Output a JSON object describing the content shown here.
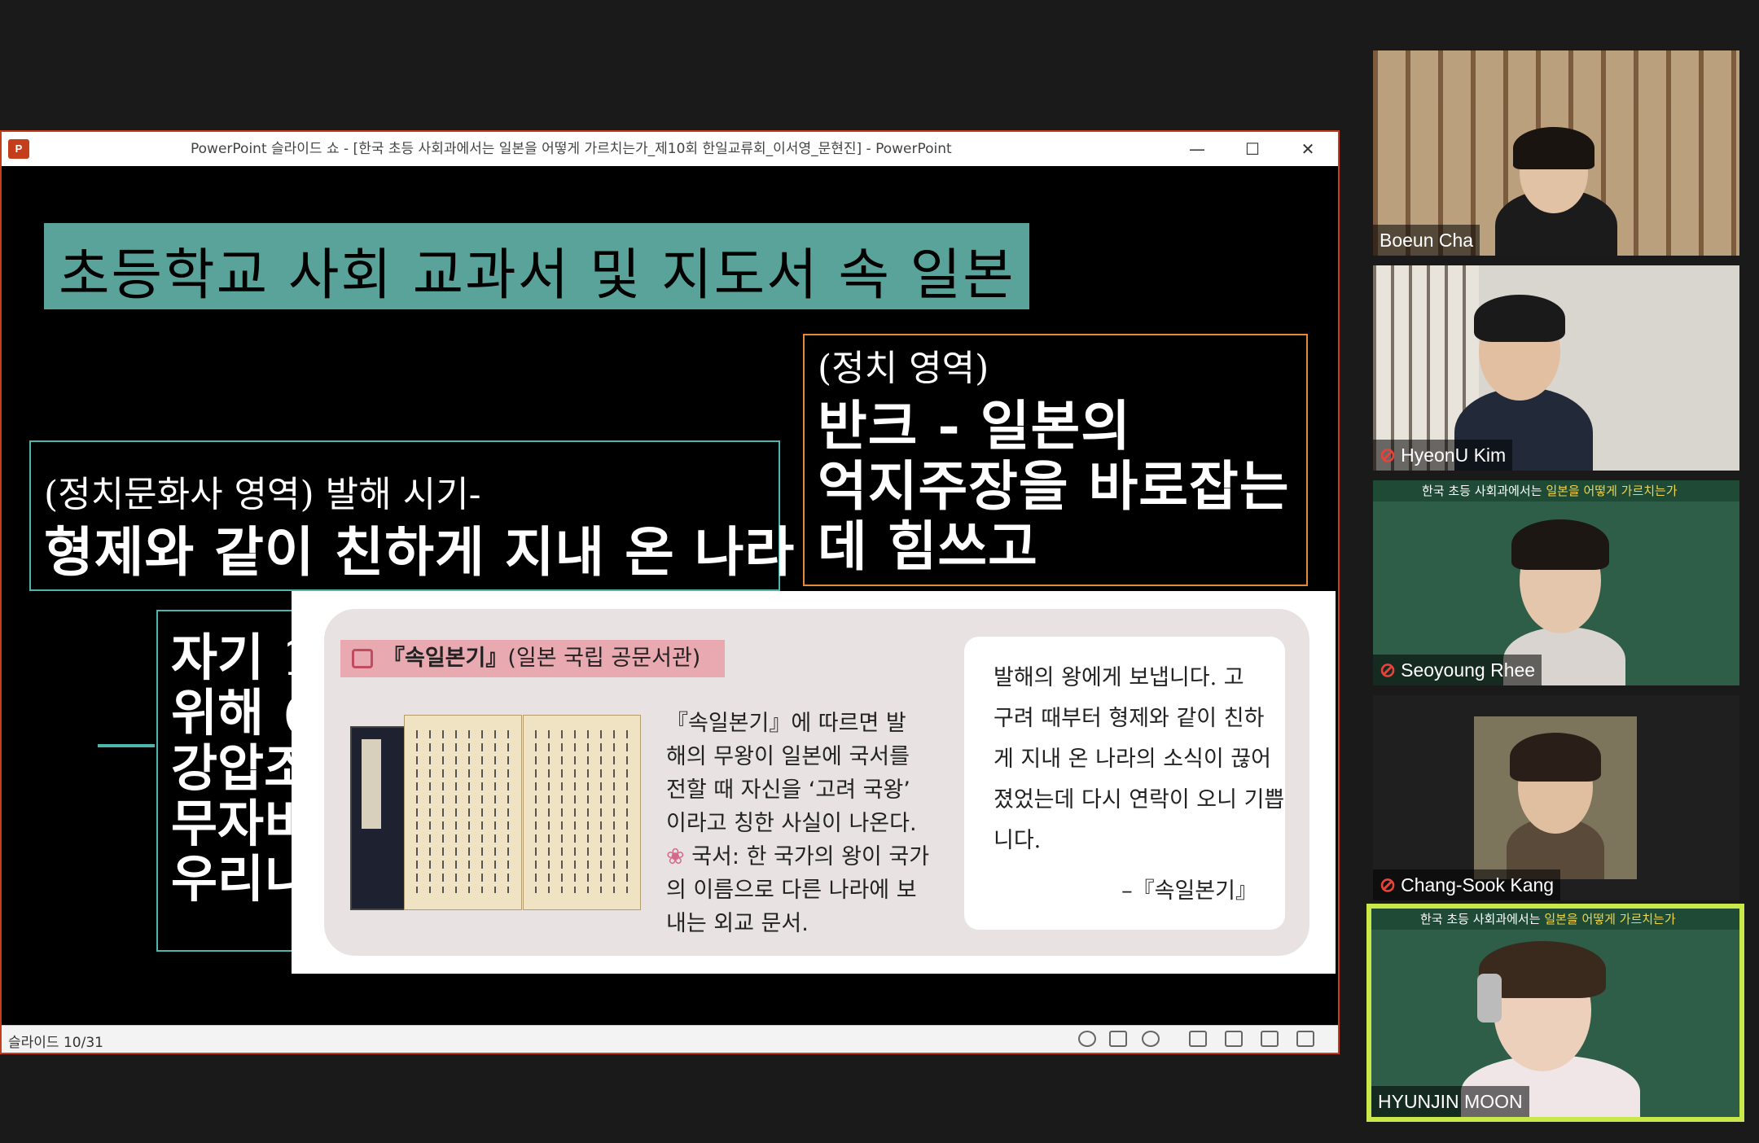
{
  "window": {
    "app_icon": "P",
    "title": "PowerPoint 슬라이드 쇼 - [한국 초등 사회과에서는 일본을 어떻게 가르치는가_제10회 한일교류회_이서영_문현진] - PowerPoint",
    "minimize": "—",
    "maximize": "☐",
    "close": "✕"
  },
  "slide": {
    "title": "초등학교 사회 교과서 및 지도서 속 일본",
    "left_box": {
      "sub": "(정치문화사 영역) 발해 시기-",
      "main": "형제와 같이 친하게 지내 온 나라"
    },
    "right_box": {
      "sub": "(정치 영역)",
      "lines": [
        "반크 - 일본의",
        "억지주장을 바로잡는",
        "데 힘쓰고"
      ]
    },
    "bottom_box": {
      "lines": [
        "자기 1",
        "위해 (",
        "강압조",
        "무자비",
        "우리니"
      ]
    },
    "textbook": {
      "tag_bold": "『속일본기』",
      "tag_rest": "(일본 국립 공문서관)",
      "para": [
        "『속일본기』에 따르면 발",
        "해의 무왕이 일본에 국서를",
        "전할 때 자신을 ‘고려 국왕’",
        "이라고 칭한 사실이 나온다."
      ],
      "note_mark": "❀",
      "note": [
        " 국서: 한 국가의 왕이 국가",
        "의 이름으로 다른 나라에 보",
        "내는 외교 문서."
      ],
      "quote": [
        "발해의 왕에게 보냅니다. 고",
        "구려 때부터 형제와 같이 친하",
        "게 지내 온 나라의 소식이 끊어",
        "졌었는데 다시 연락이 오니 기쁩",
        "니다."
      ],
      "quote_source": "–『속일본기』"
    }
  },
  "statusbar": {
    "slide_indicator": "슬라이드 10/31"
  },
  "participants": [
    {
      "name": "Boeun Cha",
      "muted": false
    },
    {
      "name": "HyeonU Kim",
      "muted": true
    },
    {
      "name": "Seoyoung Rhee",
      "muted": true
    },
    {
      "name": "Chang-Sook Kang",
      "muted": true
    },
    {
      "name": "HYUNJIN MOON",
      "muted": false,
      "active": true
    }
  ],
  "shared_screen_header": {
    "prefix": "한국 초등 사회과에서는 ",
    "highlight": "일본을 어떻게 가르치는가"
  },
  "colors": {
    "title_band": "#5aa39a",
    "teal_border": "#4db6ac",
    "orange_border": "#e58a3a",
    "ppt_red": "#c43e1c",
    "active_speaker": "#c9e84a",
    "mute_red": "#e8423a"
  }
}
